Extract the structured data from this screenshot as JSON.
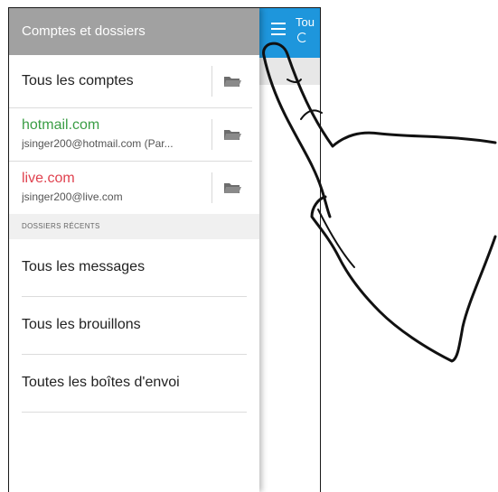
{
  "app": {
    "title_partial": "Tou"
  },
  "drawer": {
    "header_title": "Comptes et dossiers",
    "accounts": [
      {
        "title": "Tous les comptes",
        "subtitle": "",
        "title_color": "#222222"
      },
      {
        "title": "hotmail.com",
        "subtitle": "jsinger200@hotmail.com (Par...",
        "title_color": "#3a9d45"
      },
      {
        "title": "live.com",
        "subtitle": "jsinger200@live.com",
        "title_color": "#e0424f"
      }
    ],
    "section_label": "DOSSIERS RÉCENTS",
    "recent_folders": [
      "Tous les messages",
      "Tous les brouillons",
      "Toutes les boîtes d'envoi"
    ]
  },
  "colors": {
    "app_header": "#1e96dc",
    "drawer_header": "#a1a1a1"
  }
}
